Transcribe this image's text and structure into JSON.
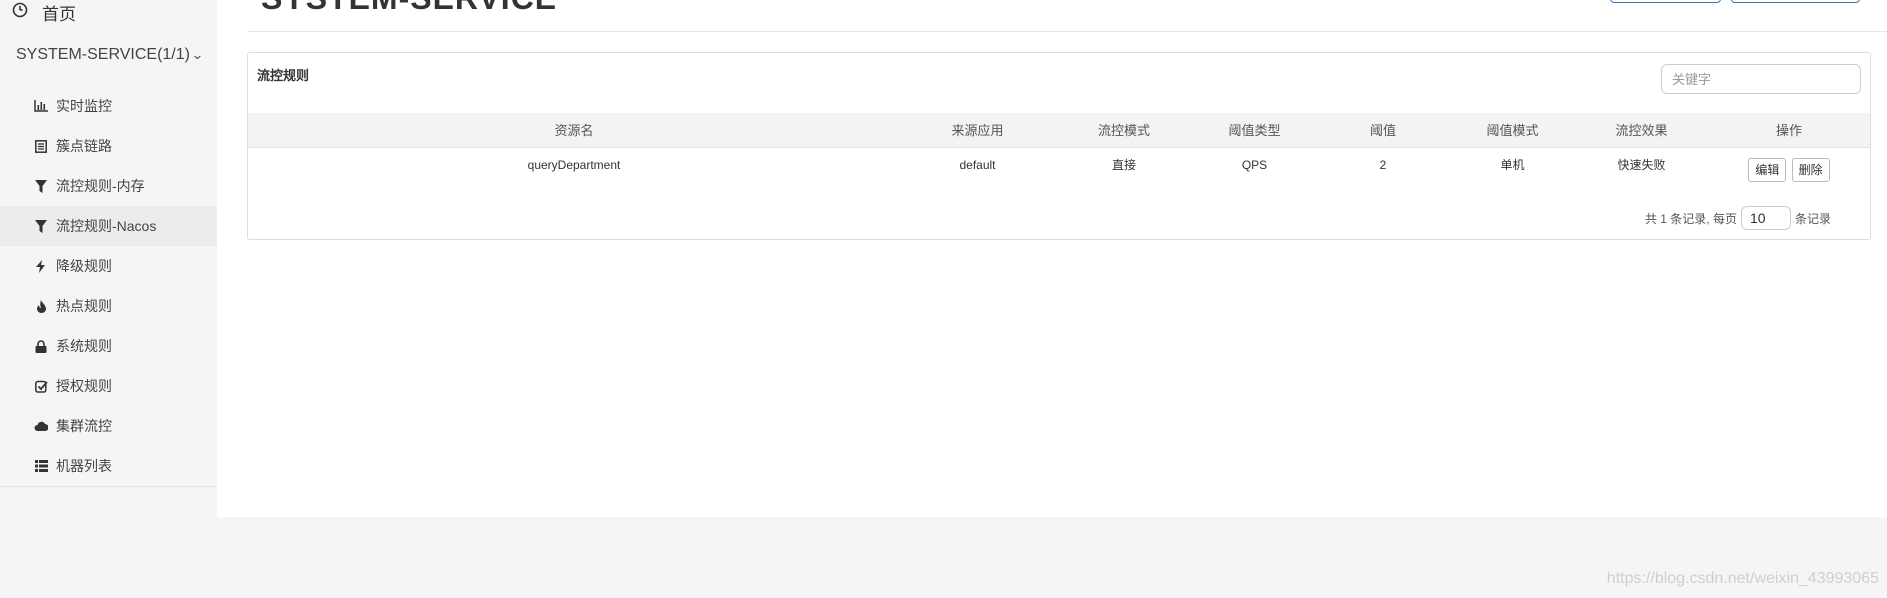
{
  "sidebar": {
    "home_label": "首页",
    "app_label": "SYSTEM-SERVICE(1/1)",
    "items": [
      {
        "label": "实时监控",
        "icon": "bar-chart-icon"
      },
      {
        "label": "簇点链路",
        "icon": "list-icon"
      },
      {
        "label": "流控规则-内存",
        "icon": "filter-icon"
      },
      {
        "label": "流控规则-Nacos",
        "icon": "filter-icon",
        "active": true
      },
      {
        "label": "降级规则",
        "icon": "flash-icon"
      },
      {
        "label": "热点规则",
        "icon": "fire-icon"
      },
      {
        "label": "系统规则",
        "icon": "lock-icon"
      },
      {
        "label": "授权规则",
        "icon": "check-icon"
      },
      {
        "label": "集群流控",
        "icon": "cloud-icon"
      },
      {
        "label": "机器列表",
        "icon": "th-list-icon"
      }
    ]
  },
  "header": {
    "title": "SYSTEM-SERVICE"
  },
  "panel": {
    "title": "流控规则",
    "search_placeholder": "关键字"
  },
  "table": {
    "columns": [
      "资源名",
      "来源应用",
      "流控模式",
      "阈值类型",
      "阈值",
      "阈值模式",
      "流控效果",
      "操作"
    ],
    "rows": [
      {
        "resource": "queryDepartment",
        "origin": "default",
        "mode": "直接",
        "threshold_type": "QPS",
        "threshold": "2",
        "threshold_mode": "单机",
        "effect": "快速失败",
        "edit_label": "编辑",
        "delete_label": "删除"
      }
    ]
  },
  "pager": {
    "prefix": "共 1 条记录, 每页",
    "page_size": "10",
    "suffix": "条记录"
  },
  "watermark": "https://blog.csdn.net/weixin_43993065"
}
